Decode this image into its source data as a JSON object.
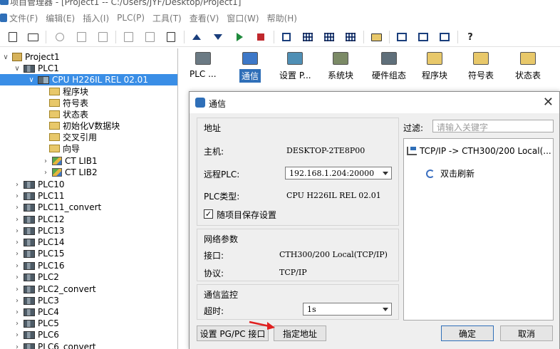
{
  "window": {
    "title": "项目管理器 - [Project1 -- C:/Users/JYF/Desktop/Project1]"
  },
  "menu": [
    "文件(F)",
    "编辑(E)",
    "插入(I)",
    "PLC(P)",
    "工具(T)",
    "查看(V)",
    "窗口(W)",
    "帮助(H)"
  ],
  "toolbar": {
    "icons": [
      "new-file-icon",
      "open-folder-icon",
      "cut-icon",
      "copy-icon",
      "paste-icon",
      "compile-icon",
      "check-icon",
      "export-icon",
      "upload-icon",
      "download-icon",
      "run-icon",
      "stop-icon",
      "monitor-icon",
      "network-view-icon",
      "table-view-icon",
      "import-icon",
      "layout-icon",
      "split-icon",
      "panel-icon",
      "help-icon"
    ]
  },
  "tree": {
    "project": "Project1",
    "plc1": "PLC1",
    "cpu": "CPU H226IL REL 02.01",
    "cpu_children": [
      "程序块",
      "符号表",
      "状态表",
      "初始化V数据块",
      "交叉引用",
      "向导"
    ],
    "libs": [
      "CT LIB1",
      "CT LIB2"
    ],
    "plcs": [
      "PLC10",
      "PLC11",
      "PLC11_convert",
      "PLC12",
      "PLC13",
      "PLC14",
      "PLC15",
      "PLC16",
      "PLC2",
      "PLC2_convert",
      "PLC3",
      "PLC4",
      "PLC5",
      "PLC6",
      "PLC6_convert"
    ]
  },
  "ribbon": {
    "items": [
      "PLC ...",
      "通信",
      "设置 P...",
      "系统块",
      "硬件组态",
      "程序块",
      "符号表",
      "状态表"
    ],
    "active": "通信"
  },
  "dialog": {
    "title": "通信",
    "address_group": {
      "title": "地址",
      "host_label": "主机:",
      "host_value": "DESKTOP-2TE8P00",
      "remote_plc_label": "远程PLC:",
      "remote_plc_value": "192.168.1.204:20000",
      "plc_type_label": "PLC类型:",
      "plc_type_value": "CPU H226IL REL 02.01",
      "save_checkbox_label": "随项目保存设置",
      "save_checked": true
    },
    "network_group": {
      "title": "网络参数",
      "interface_label": "接口:",
      "interface_value": "CTH300/200 Local(TCP/IP)",
      "protocol_label": "协议:",
      "protocol_value": "TCP/IP"
    },
    "monitor_group": {
      "title": "通信监控",
      "timeout_label": "超时:",
      "timeout_value": "1s"
    },
    "filter_label": "过滤:",
    "filter_placeholder": "请输入关键字",
    "connection_entry": "TCP/IP -> CTH300/200 Local(...",
    "refresh_entry": "双击刷新",
    "buttons": {
      "set_pgpc": "设置 PG/PC 接口",
      "set_address": "指定地址",
      "ok": "确定",
      "cancel": "取消"
    }
  },
  "colors": {
    "selection": "#3a8ee6",
    "accent": "#2f6fb8",
    "arrow": "#e02020"
  }
}
